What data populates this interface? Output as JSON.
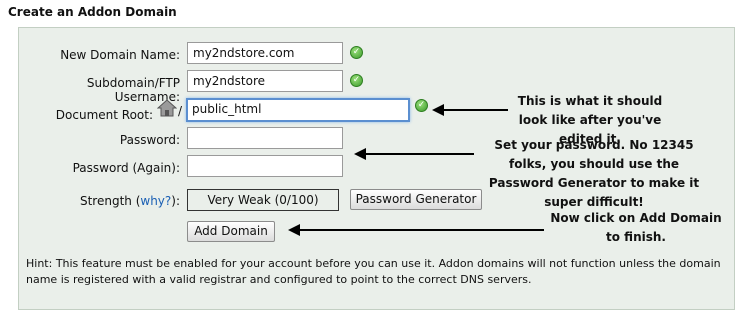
{
  "page": {
    "title": "Create an Addon Domain"
  },
  "form": {
    "new_domain": {
      "label": "New Domain Name:",
      "value": "my2ndstore.com"
    },
    "subdomain": {
      "label": "Subdomain/FTP Username:",
      "value": "my2ndstore"
    },
    "document_root": {
      "label": "Document Root:",
      "prefix": "/",
      "value": "public_html"
    },
    "password": {
      "label": "Password:",
      "value": ""
    },
    "password_again": {
      "label": "Password (Again):",
      "value": ""
    },
    "strength": {
      "label": "Strength (",
      "why_link": "why?",
      "label_end": "):",
      "value": "Very Weak (0/100)"
    },
    "password_generator_label": "Password Generator",
    "add_domain_label": "Add Domain"
  },
  "annotations": {
    "doc_root_note": "This is what it should look like after you've edited it.",
    "password_note": "Set your password. No 12345 folks, you should use the Password Generator to make it super difficult!",
    "add_domain_note": "Now click on Add Domain to finish."
  },
  "hint": "Hint: This feature must be enabled for your account before you can use it. Addon domains will not function unless the domain name is registered with a valid registrar and configured to point to the correct DNS servers.",
  "icons": {
    "valid": "check-circle-icon",
    "home": "home-icon"
  },
  "colors": {
    "panel_bg": "#eaefea",
    "link": "#1a5fb4",
    "focus": "#5b8fd0",
    "valid": "#3a9a2a"
  }
}
